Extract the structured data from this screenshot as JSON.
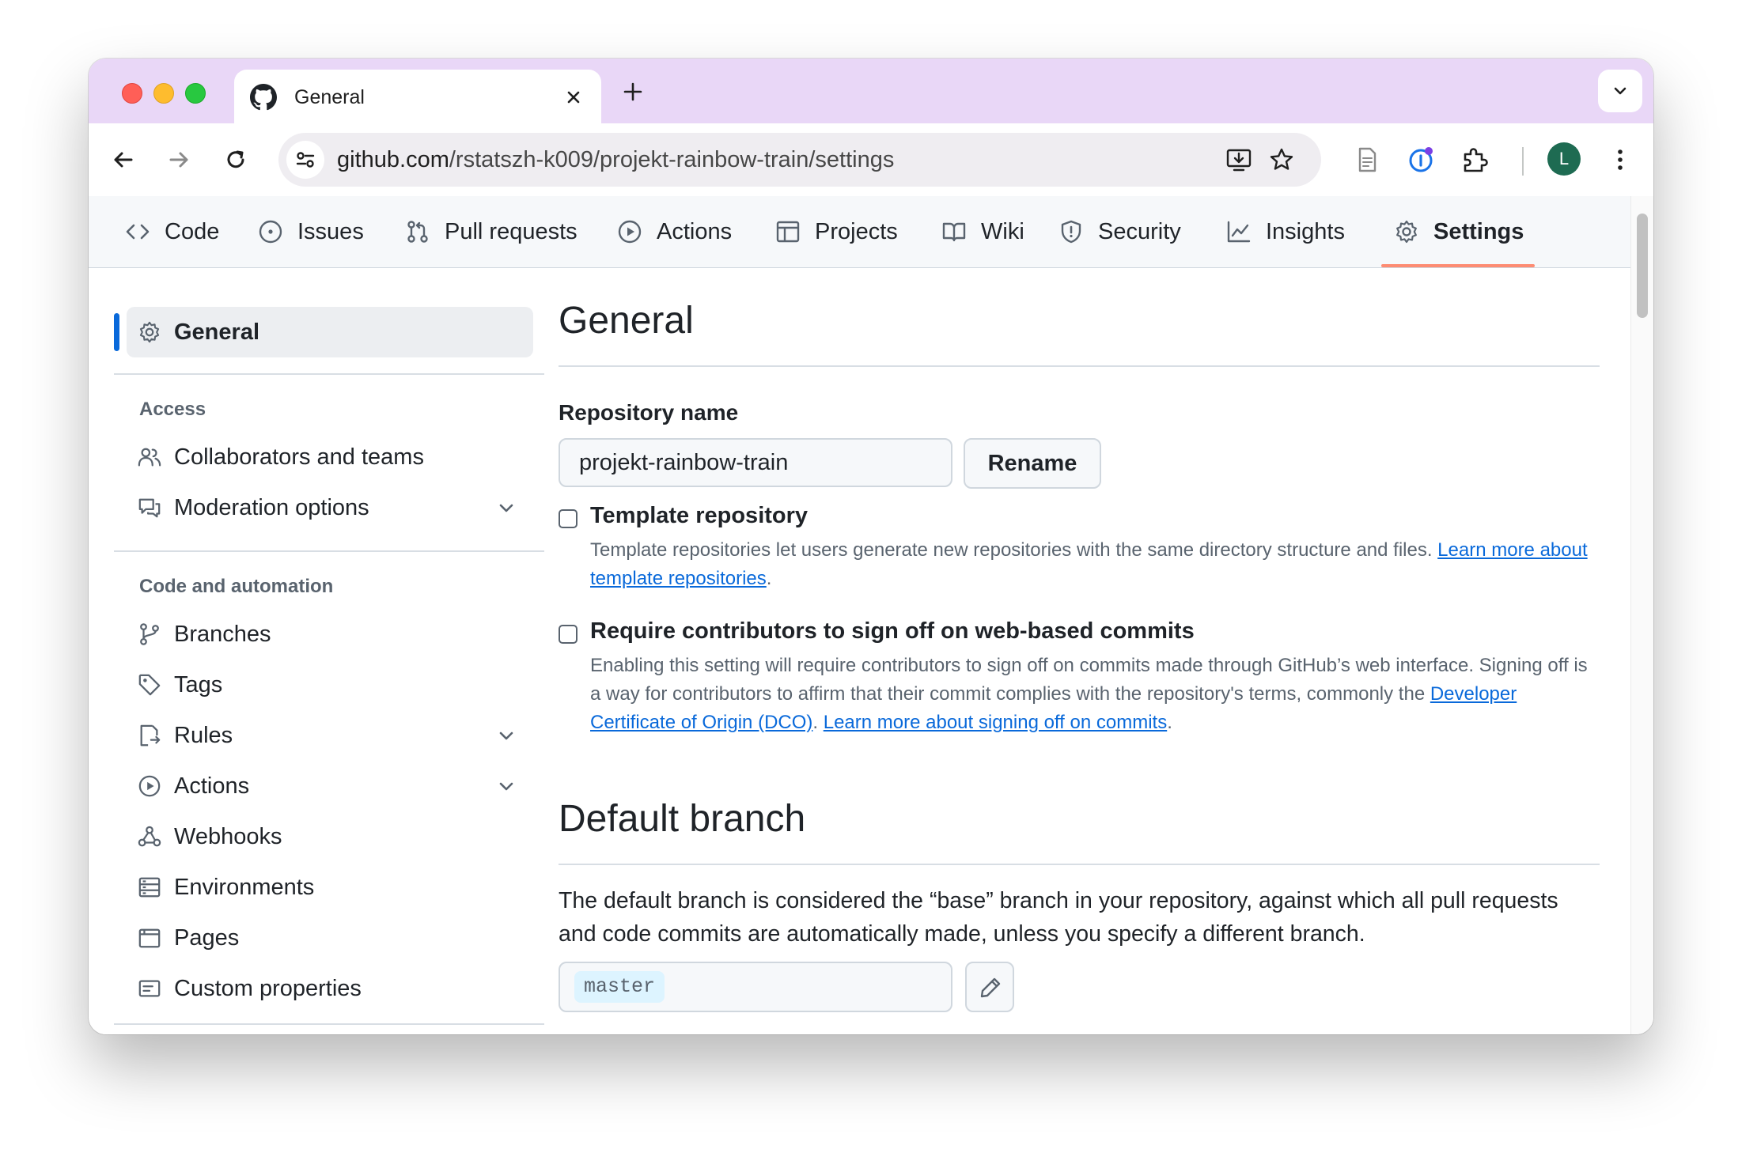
{
  "browser": {
    "tab_title": "General",
    "url_host": "github.com",
    "url_path": "/rstatszh-k009/projekt-rainbow-train/settings",
    "avatar_initial": "L"
  },
  "repo_nav": {
    "items": [
      {
        "label": "Code",
        "icon": "code-icon"
      },
      {
        "label": "Issues",
        "icon": "issue-icon"
      },
      {
        "label": "Pull requests",
        "icon": "pull-request-icon"
      },
      {
        "label": "Actions",
        "icon": "play-icon"
      },
      {
        "label": "Projects",
        "icon": "table-icon"
      },
      {
        "label": "Wiki",
        "icon": "book-icon"
      },
      {
        "label": "Security",
        "icon": "shield-icon"
      },
      {
        "label": "Insights",
        "icon": "graph-icon"
      },
      {
        "label": "Settings",
        "icon": "gear-icon",
        "active": true
      }
    ]
  },
  "sidebar": {
    "general_label": "General",
    "access_heading": "Access",
    "access_items": [
      {
        "label": "Collaborators and teams",
        "icon": "people-icon"
      },
      {
        "label": "Moderation options",
        "icon": "comment-icon",
        "expandable": true
      }
    ],
    "code_heading": "Code and automation",
    "code_items": [
      {
        "label": "Branches",
        "icon": "branch-icon"
      },
      {
        "label": "Tags",
        "icon": "tag-icon"
      },
      {
        "label": "Rules",
        "icon": "rules-icon",
        "expandable": true
      },
      {
        "label": "Actions",
        "icon": "play-icon",
        "expandable": true
      },
      {
        "label": "Webhooks",
        "icon": "webhook-icon"
      },
      {
        "label": "Environments",
        "icon": "server-icon"
      },
      {
        "label": "Pages",
        "icon": "browser-icon"
      },
      {
        "label": "Custom properties",
        "icon": "note-icon"
      }
    ]
  },
  "main": {
    "title": "General",
    "repo_name_label": "Repository name",
    "repo_name_value": "projekt-rainbow-train",
    "rename_button": "Rename",
    "template": {
      "title": "Template repository",
      "note": "Template repositories let users generate new repositories with the same directory structure and files. ",
      "link": "Learn more about template repositories",
      "end": ".",
      "checked": false
    },
    "signoff": {
      "title": "Require contributors to sign off on web-based commits",
      "note": "Enabling this setting will require contributors to sign off on commits made through GitHub’s web interface. Signing off is a way for contributors to affirm that their commit complies with the repository's terms, commonly the ",
      "link1": "Developer Certificate of Origin (DCO)",
      "mid": ". ",
      "link2": "Learn more about signing off on commits",
      "end": ".",
      "checked": false
    },
    "default_branch": {
      "title": "Default branch",
      "description": "The default branch is considered the “base” branch in your repository, against which all pull requests and code commits are automatically made, unless you specify a different branch.",
      "branch": "master"
    }
  },
  "colors": {
    "accent": "#0969da",
    "active_underline": "#fd8c73",
    "titlebar": "#e9d7f7"
  }
}
